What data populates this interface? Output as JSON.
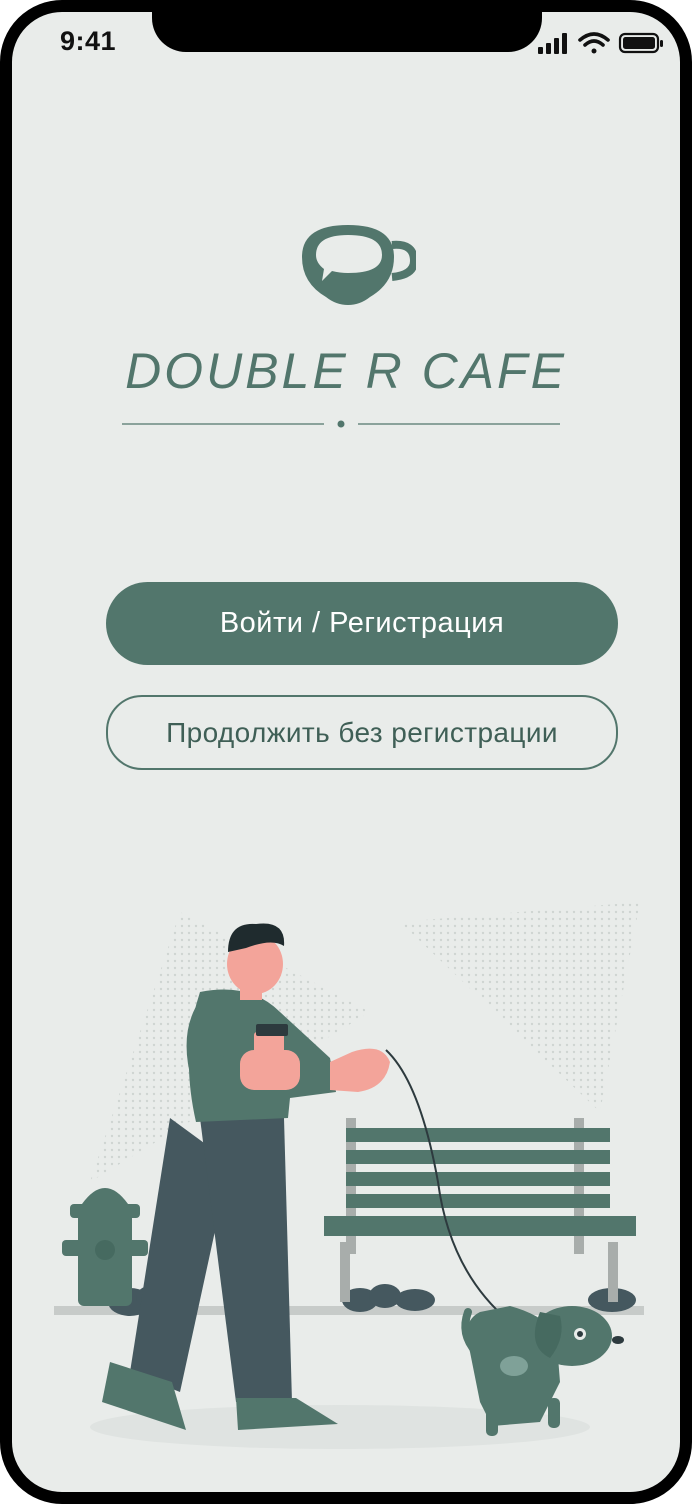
{
  "status_bar": {
    "time": "9:41",
    "icons": [
      "cellular-signal-icon",
      "wifi-icon",
      "battery-icon"
    ]
  },
  "brand": {
    "logo_icon": "coffee-cup-chat-bubble-icon",
    "name": "DOUBLE R CAFE"
  },
  "actions": {
    "login_label": "Войти / Регистрация",
    "guest_label": "Продолжить без регистрации"
  },
  "illustration": {
    "description_icon": "man-walking-dog-park-illustration"
  },
  "colors": {
    "background": "#e9ecea",
    "accent": "#52766c",
    "dark_figure": "#45585f",
    "skin": "#f3a49a"
  }
}
